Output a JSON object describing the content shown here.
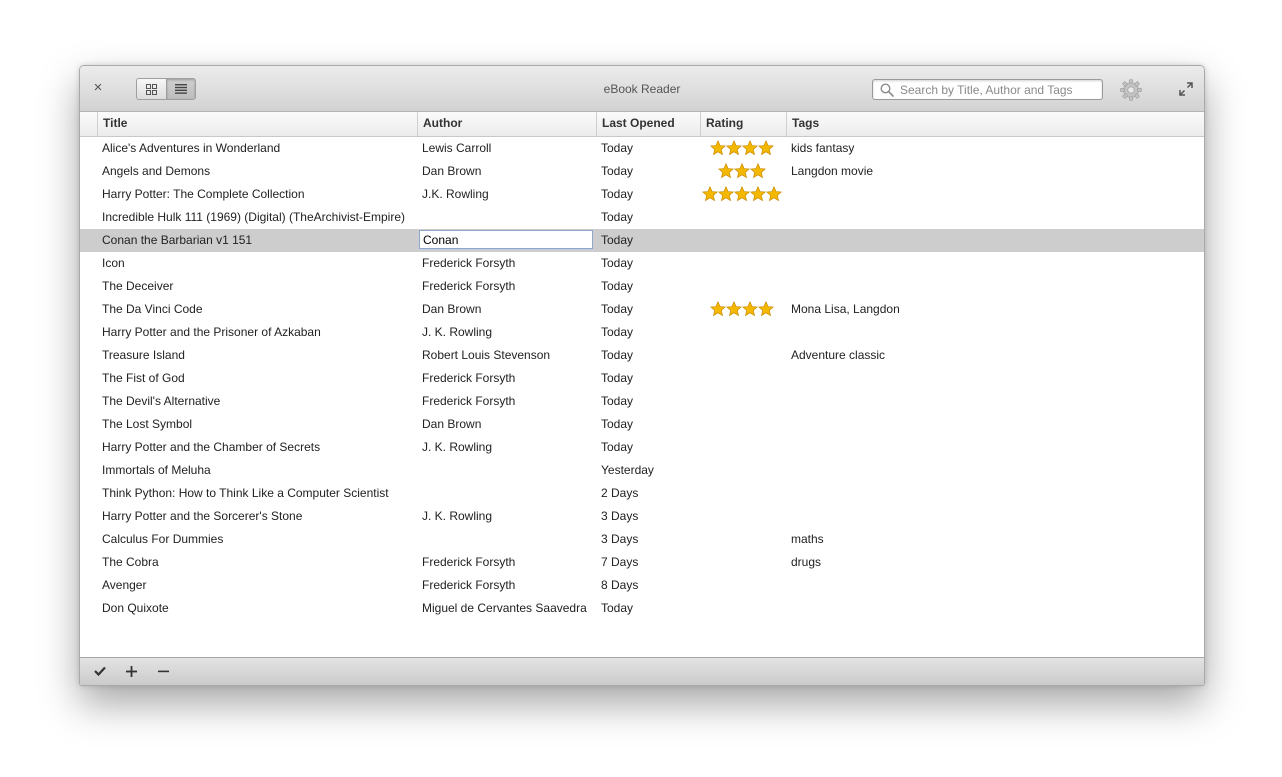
{
  "app": {
    "title": "eBook Reader"
  },
  "search": {
    "placeholder": "Search by Title, Author and Tags",
    "value": ""
  },
  "columns": {
    "title": "Title",
    "author": "Author",
    "opened": "Last Opened",
    "rating": "Rating",
    "tags": "Tags"
  },
  "books": [
    {
      "title": "Alice's Adventures in Wonderland",
      "author": "Lewis Carroll",
      "opened": "Today",
      "rating": 4,
      "tags": "kids fantasy"
    },
    {
      "title": "Angels and Demons",
      "author": "Dan Brown",
      "opened": "Today",
      "rating": 3,
      "tags": "Langdon movie"
    },
    {
      "title": "Harry Potter: The Complete Collection",
      "author": "J.K. Rowling",
      "opened": "Today",
      "rating": 5,
      "tags": ""
    },
    {
      "title": "Incredible Hulk 111 (1969) (Digital) (TheArchivist-Empire)",
      "author": "",
      "opened": "Today",
      "rating": 0,
      "tags": ""
    },
    {
      "title": "Conan the Barbarian v1 151",
      "author": "Conan",
      "opened": "Today",
      "rating": 0,
      "tags": "",
      "selected": true,
      "editing": "author"
    },
    {
      "title": "Icon",
      "author": "Frederick Forsyth",
      "opened": "Today",
      "rating": 0,
      "tags": ""
    },
    {
      "title": "The Deceiver",
      "author": "Frederick Forsyth",
      "opened": "Today",
      "rating": 0,
      "tags": ""
    },
    {
      "title": "The Da Vinci Code",
      "author": "Dan Brown",
      "opened": "Today",
      "rating": 4,
      "tags": "Mona Lisa, Langdon"
    },
    {
      "title": "Harry Potter and the Prisoner of Azkaban",
      "author": "J. K. Rowling",
      "opened": "Today",
      "rating": 0,
      "tags": ""
    },
    {
      "title": "Treasure Island",
      "author": "Robert Louis Stevenson",
      "opened": "Today",
      "rating": 0,
      "tags": "Adventure classic"
    },
    {
      "title": "The Fist of God",
      "author": "Frederick Forsyth",
      "opened": "Today",
      "rating": 0,
      "tags": ""
    },
    {
      "title": "The Devil's Alternative",
      "author": "Frederick Forsyth",
      "opened": "Today",
      "rating": 0,
      "tags": ""
    },
    {
      "title": "The Lost Symbol",
      "author": "Dan Brown",
      "opened": "Today",
      "rating": 0,
      "tags": ""
    },
    {
      "title": "Harry Potter and the Chamber of Secrets",
      "author": "J. K. Rowling",
      "opened": "Today",
      "rating": 0,
      "tags": ""
    },
    {
      "title": "Immortals of Meluha",
      "author": "",
      "opened": "Yesterday",
      "rating": 0,
      "tags": ""
    },
    {
      "title": "Think Python: How to Think Like a Computer Scientist",
      "author": "",
      "opened": "2 Days",
      "rating": 0,
      "tags": ""
    },
    {
      "title": "Harry Potter and the Sorcerer's Stone",
      "author": "J. K. Rowling",
      "opened": "3 Days",
      "rating": 0,
      "tags": ""
    },
    {
      "title": "Calculus For Dummies",
      "author": "",
      "opened": "3 Days",
      "rating": 0,
      "tags": "maths"
    },
    {
      "title": "The Cobra",
      "author": "Frederick Forsyth",
      "opened": "7 Days",
      "rating": 0,
      "tags": "drugs"
    },
    {
      "title": "Avenger",
      "author": "Frederick Forsyth",
      "opened": "8 Days",
      "rating": 0,
      "tags": ""
    },
    {
      "title": "Don Quixote",
      "author": "Miguel de Cervantes Saavedra",
      "opened": "Today",
      "rating": 0,
      "tags": ""
    }
  ],
  "icons": {
    "close": "close-icon",
    "grid_view": "grid-view-icon",
    "list_view": "list-view-icon",
    "search": "search-icon",
    "settings": "gear-icon",
    "fullscreen": "fullscreen-icon",
    "confirm": "checkmark-icon",
    "add": "plus-icon",
    "remove": "minus-icon"
  },
  "colors": {
    "selected_row": "#cdcdcd",
    "star": "#f5b800"
  }
}
